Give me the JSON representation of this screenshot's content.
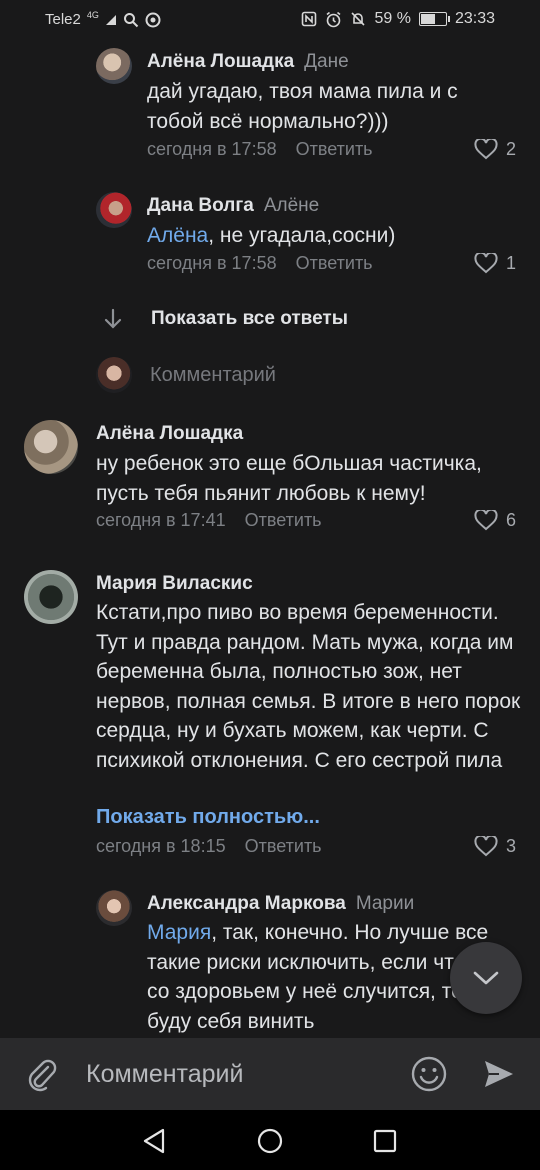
{
  "status_bar": {
    "carrier": "Tele2",
    "network": "4G",
    "battery": "59 %",
    "battery_level": 0.59,
    "time": "23:33"
  },
  "comments": [
    {
      "author": "Алёна Лошадка",
      "reply_to": "Дане",
      "text": "дай угадаю, твоя мама пила и с тобой всё нормально?)))",
      "time": "сегодня в 17:58",
      "reply_label": "Ответить",
      "likes": "2"
    },
    {
      "author": "Дана Волга",
      "reply_to": "Алёне",
      "mention": "Алёна",
      "text": ", не угадала,сосни)",
      "time": "сегодня в 17:58",
      "reply_label": "Ответить",
      "likes": "1"
    },
    {
      "author": "Алёна Лошадка",
      "text": "ну ребенок это еще бОльшая частичка, пусть тебя пьянит любовь к нему!",
      "time": "сегодня в 17:41",
      "reply_label": "Ответить",
      "likes": "6"
    },
    {
      "author": "Мария Виласкис",
      "text": "Кстати,про пиво во время беременности. Тут и правда рандом. Мать мужа, когда им беременна была, полностью зож, нет нервов, полная семья. В итоге в него порок сердца, ну и бухать можем, как черти. С психикой отклонения. С его сестрой пила",
      "show_full": "Показать полностью...",
      "time": "сегодня в 18:15",
      "reply_label": "Ответить",
      "likes": "3"
    },
    {
      "author": "Александра Маркова",
      "reply_to": "Марии",
      "mention": "Мария",
      "text": ", так, конечно. Но лучше все такие риски исключить, если что-то со здоровьем у неё случится, то я буду себя винить"
    }
  ],
  "show_all_replies": "Показать все ответы",
  "inline_comment_placeholder": "Комментарий",
  "composer": {
    "placeholder": "Комментарий"
  },
  "colors": {
    "background": "#19191a",
    "accent": "#71aaeb",
    "text": "#e1e3e6",
    "secondary": "#7d8085"
  }
}
